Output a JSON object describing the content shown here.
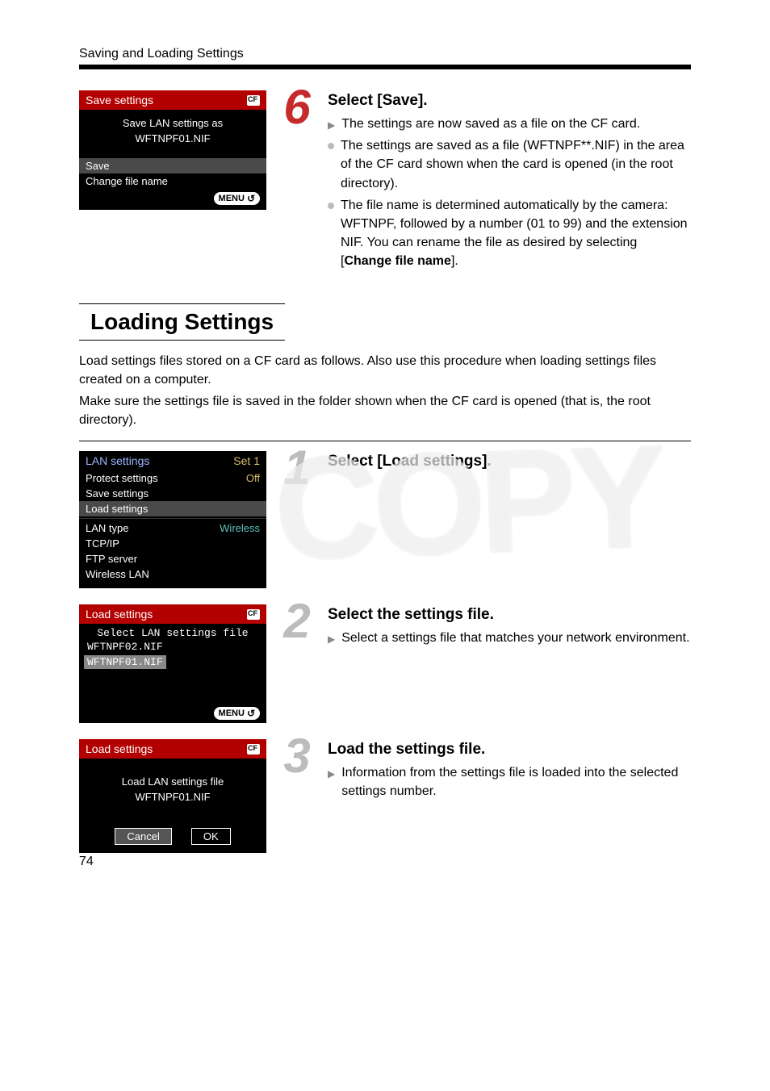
{
  "header": {
    "section": "Saving and Loading Settings"
  },
  "step6": {
    "num": "6",
    "heading": "Select [Save].",
    "b1": "The settings are now saved as a file on the CF card.",
    "b2_part1": "The settings are saved as a file (WFTNPF**.NIF) in the area of the CF card shown when the card is opened (in the root directory).",
    "b3_part1": "The file name is determined automatically by the camera: WFTNPF, followed by a number (01 to 99) and the extension NIF. You can rename the file as desired by selecting [",
    "b3_bold": "Change file name",
    "b3_part2": "]."
  },
  "screen6": {
    "title": "Save settings",
    "line1": "Save LAN settings as",
    "line2": "WFTNPF01.NIF",
    "save": "Save",
    "change": "Change file name",
    "menu": "MENU"
  },
  "loading": {
    "title": "Loading Settings",
    "p1": "Load settings files stored on a CF card as follows. Also use this procedure when loading settings files created on a computer.",
    "p2": "Make sure the settings file is saved in the folder shown when the CF card is opened (that is, the root directory)."
  },
  "screenA": {
    "title": "LAN settings",
    "set": "Set 1",
    "r1": "Protect settings",
    "r1v": "Off",
    "r2": "Save settings",
    "r3": "Load settings",
    "r4": "LAN type",
    "r4v": "Wireless",
    "r5": "TCP/IP",
    "r6": "FTP server",
    "r7": "Wireless LAN"
  },
  "step1": {
    "num": "1",
    "heading": "Select [Load settings]."
  },
  "screenB": {
    "title": "Load settings",
    "sub": "Select LAN settings file",
    "f1": "WFTNPF02.NIF",
    "f2": "WFTNPF01.NIF",
    "menu": "MENU"
  },
  "step2": {
    "num": "2",
    "heading": "Select the settings file.",
    "b1": "Select a settings file that matches your network environment."
  },
  "screenC": {
    "title": "Load settings",
    "line1": "Load LAN settings file",
    "line2": "WFTNPF01.NIF",
    "cancel": "Cancel",
    "ok": "OK"
  },
  "step3": {
    "num": "3",
    "heading": "Load the settings file.",
    "b1": "Information from the settings file is loaded into the selected settings number."
  },
  "watermark": "COPY",
  "pageNum": "74"
}
